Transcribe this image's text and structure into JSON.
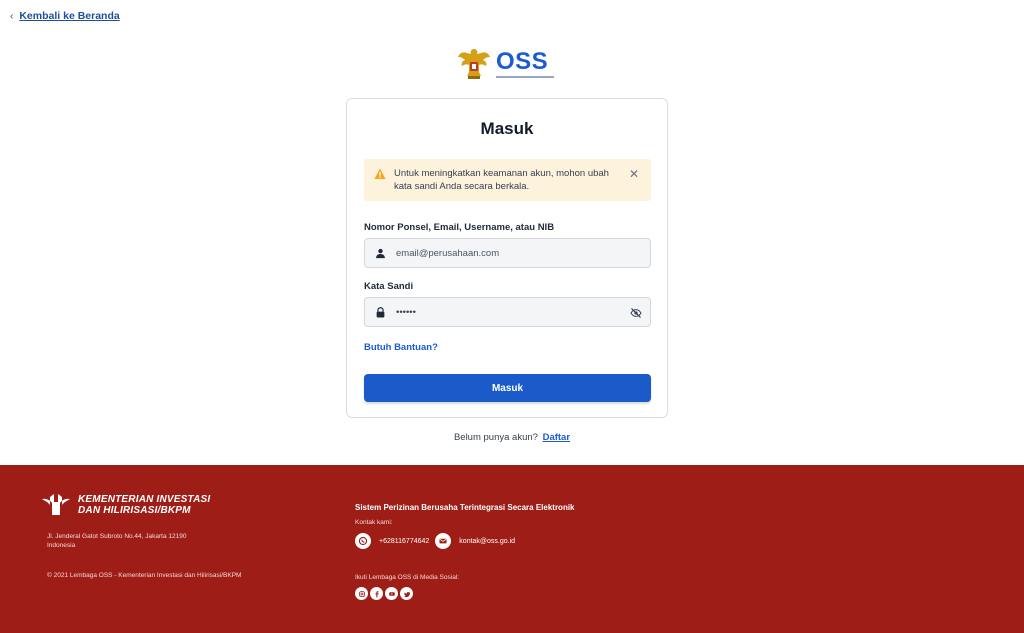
{
  "nav": {
    "back_label": "Kembali ke Beranda"
  },
  "brand": {
    "name": "OSS"
  },
  "login": {
    "title": "Masuk",
    "alert_message": "Untuk meningkatkan keamanan akun, mohon ubah kata sandi Anda secara berkala.",
    "identifier_label": "Nomor Ponsel, Email, Username, atau NIB",
    "identifier_placeholder": "email@perusahaan.com",
    "password_label": "Kata Sandi",
    "password_value": "••••••",
    "help_link": "Butuh Bantuan?",
    "submit_label": "Masuk"
  },
  "signup": {
    "prompt": "Belum punya akun?",
    "link": "Daftar"
  },
  "footer": {
    "ministry_line1": "KEMENTERIAN INVESTASI",
    "ministry_line2": "DAN HILIRISASI/BKPM",
    "address_line1": "Jl. Jenderal Gatot Subroto No.44, Jakarta 12190",
    "address_line2": "Indonesia",
    "copyright": "© 2021 Lembaga OSS - Kementerian Investasi dan Hilirisasi/BKPM",
    "system_title": "Sistem Perizinan Berusaha Terintegrasi Secara Elektronik",
    "contact_label": "Kontak kami:",
    "phone": "+628116774642",
    "email": "kontak@oss.go.id",
    "social_label": "Ikuti Lembaga OSS di Media Sosial:",
    "social_icons": [
      "instagram-icon",
      "facebook-icon",
      "youtube-icon",
      "twitter-icon"
    ]
  },
  "colors": {
    "primary": "#1a5bc9",
    "footer_bg": "#9e1e17",
    "alert_bg": "#fdf3dd",
    "warning": "#f5a623"
  }
}
